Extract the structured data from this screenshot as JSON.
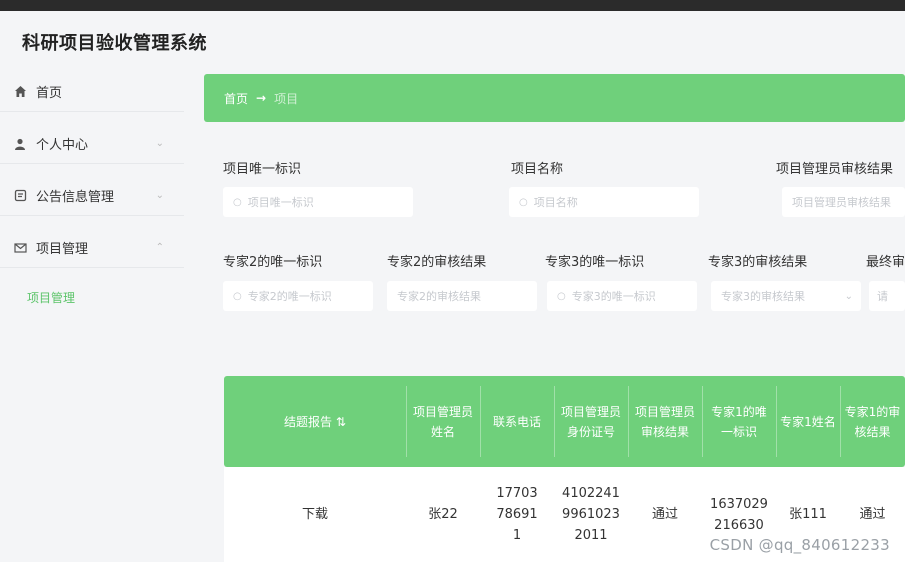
{
  "app": {
    "title": "科研项目验收管理系统"
  },
  "sidebar": {
    "items": [
      {
        "label": "首页"
      },
      {
        "label": "个人中心"
      },
      {
        "label": "公告信息管理"
      },
      {
        "label": "项目管理"
      }
    ],
    "sub_item": "项目管理"
  },
  "breadcrumb": {
    "home": "首页",
    "arrow": "→",
    "current": "项目"
  },
  "filters": {
    "row1": [
      {
        "label": "项目唯一标识",
        "placeholder": "项目唯一标识"
      },
      {
        "label": "项目名称",
        "placeholder": "项目名称"
      },
      {
        "label": "项目管理员审核结果",
        "placeholder": "项目管理员审核结果"
      }
    ],
    "row2": [
      {
        "label": "专家2的唯一标识",
        "placeholder": "专家2的唯一标识"
      },
      {
        "label": "专家2的审核结果",
        "placeholder": "专家2的审核结果"
      },
      {
        "label": "专家3的唯一标识",
        "placeholder": "专家3的唯一标识"
      },
      {
        "label": "专家3的审核结果",
        "placeholder": "专家3的审核结果"
      },
      {
        "label": "最终审"
      }
    ]
  },
  "table": {
    "headers": [
      "结题报告",
      "项目管理员姓名",
      "联系电话",
      "项目管理员身份证号",
      "项目管理员审核结果",
      "专家1的唯一标识",
      "专家1姓名",
      "专家1的审核结果"
    ],
    "rows": [
      [
        "下载",
        "张22",
        "17703786911",
        "410224199610232011",
        "通过",
        "1637029216630",
        "张111",
        "通过"
      ]
    ]
  },
  "watermark": "CSDN @qq_840612233"
}
